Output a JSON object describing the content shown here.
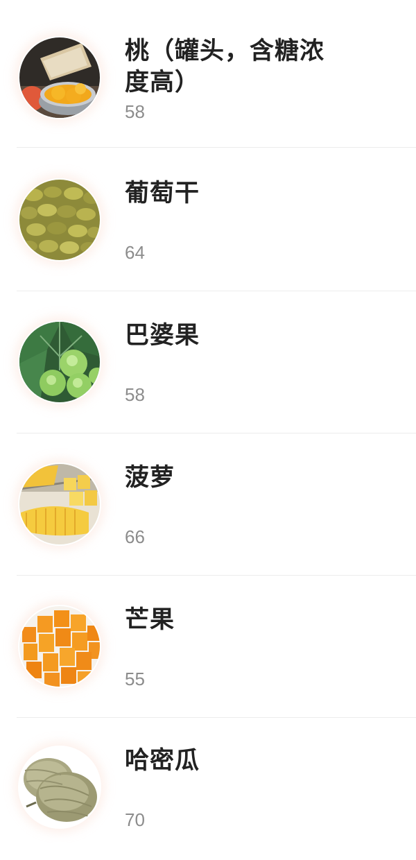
{
  "fruits": [
    {
      "name": "桃（罐头，含糖浓度高）",
      "gi": "58",
      "image": "canned-peach"
    },
    {
      "name": "葡萄干",
      "gi": "64",
      "image": "raisins"
    },
    {
      "name": "巴婆果",
      "gi": "58",
      "image": "pawpaw"
    },
    {
      "name": "菠萝",
      "gi": "66",
      "image": "pineapple"
    },
    {
      "name": "芒果",
      "gi": "55",
      "image": "mango"
    },
    {
      "name": "哈密瓜",
      "gi": "70",
      "image": "hami-melon"
    }
  ]
}
